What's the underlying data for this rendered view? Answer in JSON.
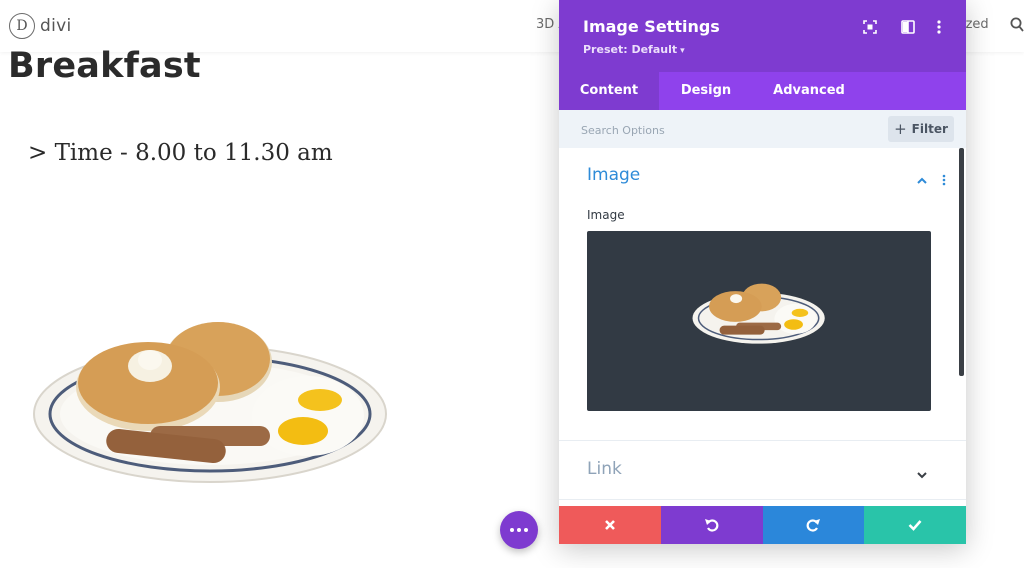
{
  "site": {
    "logo_letter": "D",
    "logo_text": "divi",
    "nav_left": "3D A",
    "nav_right": "ized"
  },
  "page": {
    "title": "Breakfast",
    "time_text": "> Time - 8.00 to 11.30 am"
  },
  "modal": {
    "title": "Image Settings",
    "preset": "Preset: Default",
    "tabs": [
      {
        "label": "Content",
        "active": true
      },
      {
        "label": "Design",
        "active": false
      },
      {
        "label": "Advanced",
        "active": false
      }
    ],
    "search": {
      "placeholder": "Search Options",
      "value": ""
    },
    "filter_label": "Filter",
    "sections": {
      "image": {
        "title": "Image",
        "field_label": "Image",
        "expanded": true
      },
      "link": {
        "title": "Link",
        "expanded": false
      }
    },
    "footer": {
      "buttons": [
        {
          "icon": "close-icon",
          "color": "#ef5a5a"
        },
        {
          "icon": "undo-icon",
          "color": "#7e3bd0"
        },
        {
          "icon": "redo-icon",
          "color": "#2b87da"
        },
        {
          "icon": "check-icon",
          "color": "#29c4a9"
        }
      ]
    }
  },
  "colors": {
    "modal_header": "#7e3bd0",
    "tabs_bar": "#8f42ec",
    "section_title": "#2e8bd8",
    "preview_bg": "#323a44"
  }
}
